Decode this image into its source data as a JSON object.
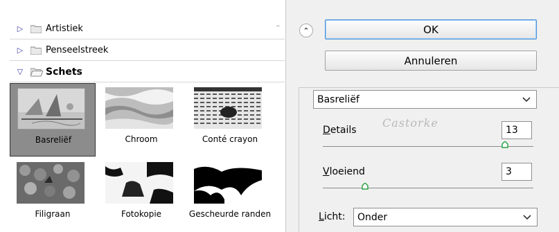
{
  "categories": [
    {
      "label": "Artistiek",
      "expanded": false
    },
    {
      "label": "Penseelstreek",
      "expanded": false
    },
    {
      "label": "Schets",
      "expanded": true
    }
  ],
  "thumbnails": [
    {
      "label": "Basreliëf",
      "selected": true
    },
    {
      "label": "Chroom",
      "selected": false
    },
    {
      "label": "Conté crayon",
      "selected": false
    },
    {
      "label": "Filigraan",
      "selected": false
    },
    {
      "label": "Fotokopie",
      "selected": false
    },
    {
      "label": "Gescheurde randen",
      "selected": false
    }
  ],
  "buttons": {
    "ok": "OK",
    "cancel": "Annuleren"
  },
  "filter_select": {
    "value": "Basreliëf"
  },
  "watermark": "Castorke",
  "params": {
    "details": {
      "label_first": "D",
      "label_rest": "etails",
      "value": "13",
      "max": 15
    },
    "smoothness": {
      "label_first": "V",
      "label_rest": "loeiend",
      "value": "3",
      "max": 15
    }
  },
  "light": {
    "label_first": "L",
    "label_rest": "icht:",
    "value": "Onder"
  },
  "colors": {
    "accent": "#4a90d9",
    "knob": "#2fa046",
    "triangle": "#3a3aa0"
  }
}
